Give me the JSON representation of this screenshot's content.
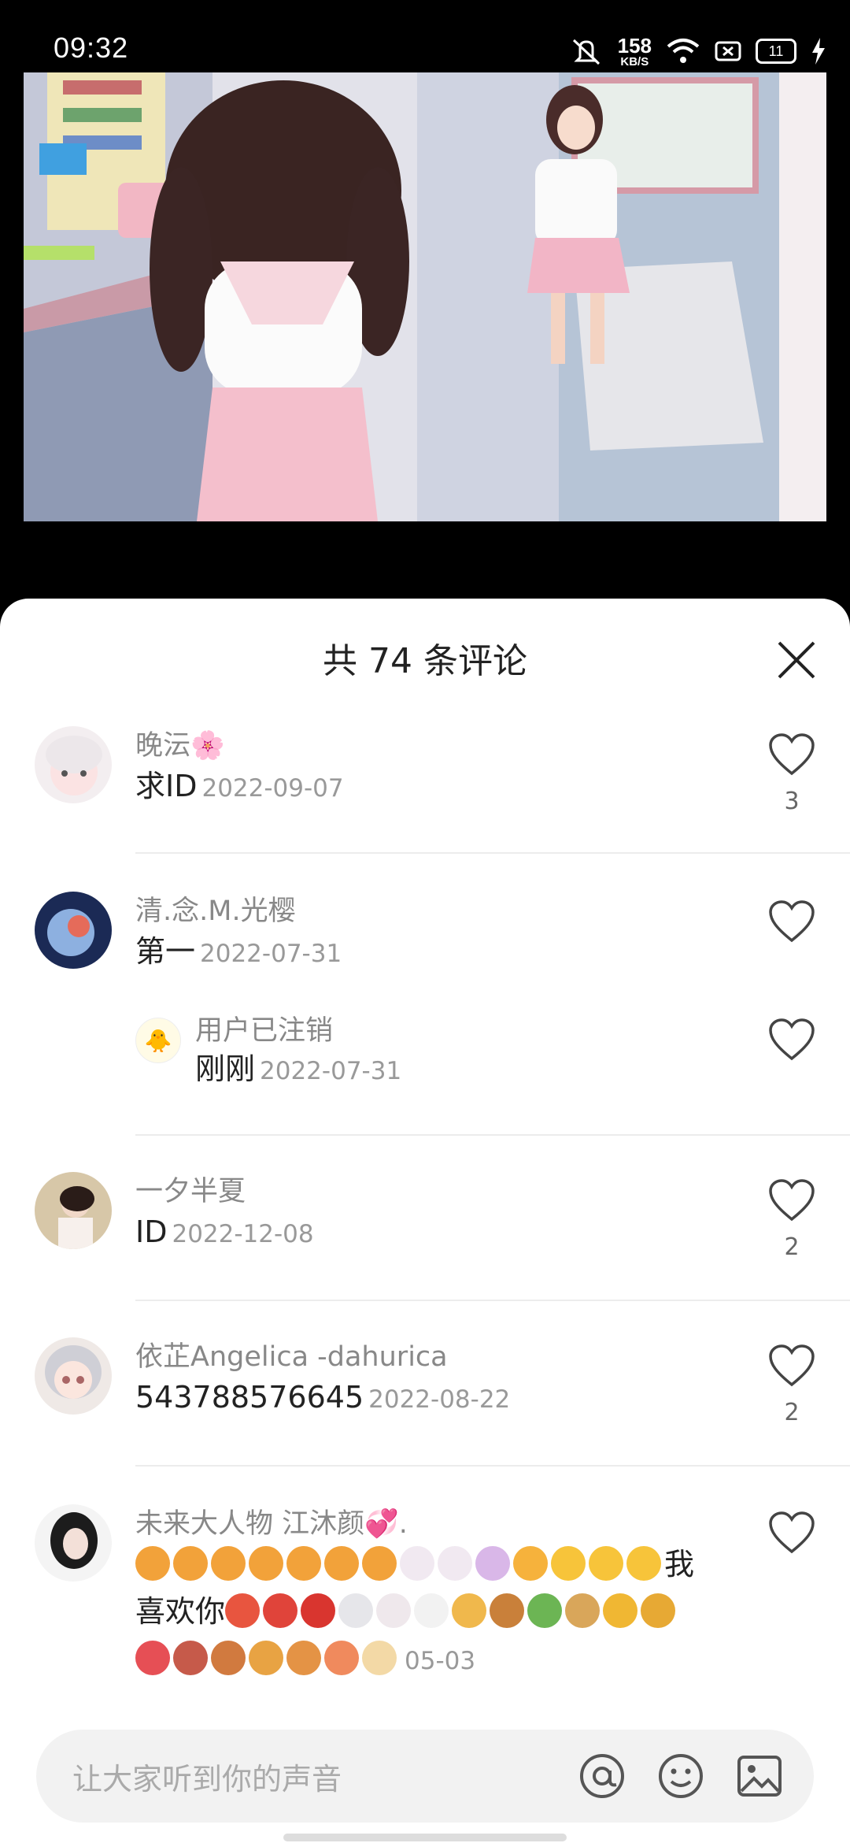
{
  "status": {
    "time": "09:32",
    "speed_value": "158",
    "speed_unit": "KB/S",
    "battery": "11"
  },
  "sheet": {
    "title": "共 74 条评论",
    "close_icon": "close-icon"
  },
  "comments": [
    {
      "name": "晚沄🌸",
      "text": "求ID",
      "date": "2022-09-07",
      "likes": "3"
    },
    {
      "name": "清.念.M.光樱",
      "text": "第一",
      "date": "2022-07-31",
      "likes": "",
      "reply": {
        "name": "用户已注销",
        "text": "刚刚",
        "date": "2022-07-31"
      }
    },
    {
      "name": "一夕半夏",
      "text": "ID",
      "date": "2022-12-08",
      "likes": "2"
    },
    {
      "name": "依芷Angelica -dahurica",
      "text": "543788576645",
      "date": "2022-08-22",
      "likes": "2"
    },
    {
      "name": "未来大人物 江沐颜💞.",
      "line1": "我",
      "line2": "喜欢你",
      "date": "05-03",
      "likes": ""
    }
  ],
  "input": {
    "placeholder": "让大家听到你的声音"
  },
  "colors": {
    "accent_pink": "#f3b7c9",
    "text_dark": "#222222",
    "text_muted": "#888888"
  }
}
